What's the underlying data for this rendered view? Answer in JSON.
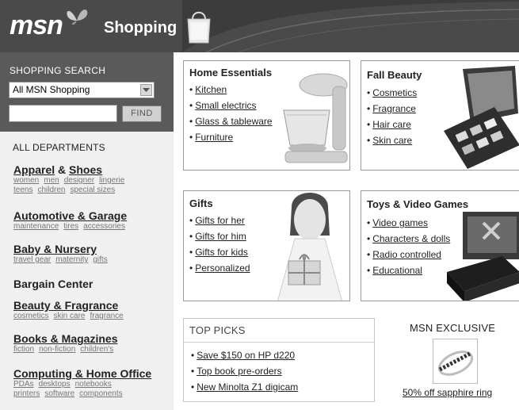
{
  "header": {
    "logo": "msn",
    "section_title": "Shopping"
  },
  "search": {
    "heading": "SHOPPING SEARCH",
    "scope_selected": "All MSN Shopping",
    "query_value": "",
    "find_label": "FIND"
  },
  "departments": {
    "heading": "ALL DEPARTMENTS",
    "apparel": {
      "title_a": "Apparel",
      "amp": " & ",
      "title_b": "Shoes",
      "subs": [
        "women",
        "men",
        "designer",
        "lingerie",
        "teens",
        "children",
        "special sizes"
      ]
    },
    "automotive": {
      "title": "Automotive & Garage",
      "subs": [
        "maintenance",
        "tires",
        "accessories"
      ]
    },
    "baby": {
      "title": "Baby & Nursery",
      "subs": [
        "travel gear",
        "maternity",
        "gifts"
      ]
    },
    "bargain": {
      "title": "Bargain Center"
    },
    "beauty": {
      "title": "Beauty & Fragrance",
      "subs": [
        "cosmetics",
        "skin care",
        "fragrance"
      ]
    },
    "books": {
      "title": "Books & Magazines",
      "subs": [
        "fiction",
        "non-fiction",
        "children's"
      ]
    },
    "computing": {
      "title": "Computing & Home Office",
      "subs": [
        "PDAs",
        "desktops",
        "notebooks",
        "printers",
        "software",
        "components"
      ]
    }
  },
  "promos": {
    "home": {
      "title": "Home Essentials",
      "links": [
        "Kitchen",
        "Small electrics",
        "Glass & tableware",
        "Furniture"
      ]
    },
    "beauty": {
      "title": "Fall Beauty",
      "links": [
        "Cosmetics",
        "Fragrance",
        "Hair care",
        "Skin care"
      ]
    },
    "gifts": {
      "title": "Gifts",
      "links": [
        "Gifts for her",
        "Gifts for him",
        "Gifts for kids",
        "Personalized"
      ]
    },
    "toys": {
      "title": "Toys & Video Games",
      "links": [
        "Video games",
        "Characters & dolls",
        "Radio controlled",
        "Educational"
      ]
    }
  },
  "top_picks": {
    "heading": "TOP PICKS",
    "links": [
      "Save $150 on HP d220",
      "Top book pre-orders",
      "New Minolta Z1 digicam"
    ]
  },
  "exclusive": {
    "heading": "MSN EXCLUSIVE",
    "link": "50% off sapphire ring"
  },
  "icons": [
    "butterfly-icon",
    "shopping-bag-icon",
    "dropdown-arrow-icon",
    "ring-image"
  ],
  "colors": {
    "header_bg": "#4a4a4a",
    "search_bg": "#5a5a5a",
    "sidebar_bg": "#f0f0f0"
  }
}
